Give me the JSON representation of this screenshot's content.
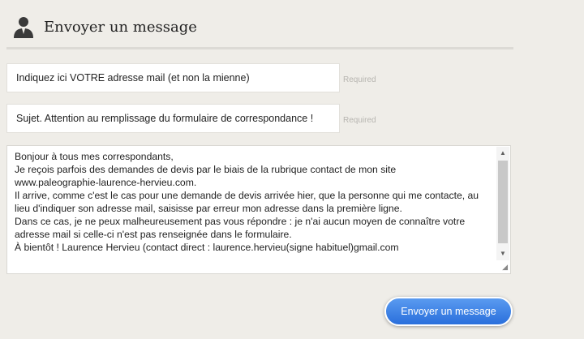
{
  "header": {
    "title": "Envoyer un message",
    "icon": "user-icon"
  },
  "form": {
    "email_value": "Indiquez ici VOTRE adresse mail (et non la mienne)",
    "subject_value": "Sujet. Attention au remplissage du formulaire de correspondance !",
    "required_label": "Required",
    "message_lines": [
      "Bonjour à tous mes correspondants,",
      "Je reçois parfois des demandes de devis par le biais de la rubrique contact de mon site",
      "www.paleographie-laurence-hervieu.com.",
      "Il arrive, comme c'est le cas pour une demande de devis arrivée hier, que la personne qui me contacte, au",
      "lieu d'indiquer son adresse mail, saisisse par erreur mon adresse dans la première ligne.",
      "Dans ce cas, je ne peux malheureusement pas vous répondre : je n'ai aucun moyen de connaître votre",
      "adresse mail si celle-ci n'est pas renseignée dans le formulaire.",
      "À bientôt ! Laurence Hervieu (contact direct : laurence.hervieu(signe habituel)gmail.com"
    ],
    "send_label": "Envoyer un message"
  },
  "colors": {
    "background": "#efede8",
    "button": "#2a6fdc"
  }
}
